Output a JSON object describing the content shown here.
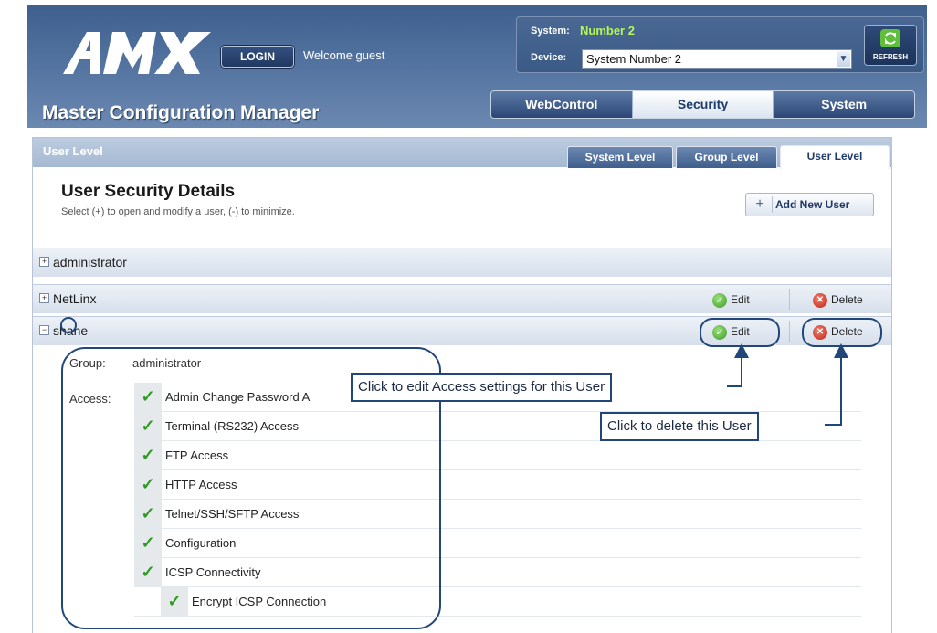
{
  "header": {
    "logo_text": "AMX",
    "login_label": "LOGIN",
    "welcome": "Welcome guest",
    "title": "Master Configuration Manager",
    "system_label": "System:",
    "system_value": "Number 2",
    "device_label": "Device:",
    "device_value": "System Number 2",
    "refresh_label": "REFRESH",
    "nav": [
      "WebControl",
      "Security",
      "System"
    ],
    "nav_active": "Security"
  },
  "panel": {
    "title": "User Level",
    "subtabs": [
      "System Level",
      "Group Level",
      "User Level"
    ],
    "active_subtab": "User Level",
    "section_title": "User Security Details",
    "section_subtitle": "Select (+) to open and modify a user, (-) to minimize.",
    "add_button": "Add New User"
  },
  "users": [
    {
      "name": "administrator",
      "expanded": false,
      "edit": "",
      "delete": ""
    },
    {
      "name": "NetLinx",
      "expanded": false,
      "edit": "Edit",
      "delete": "Delete"
    },
    {
      "name": "shane",
      "expanded": true,
      "edit": "Edit",
      "delete": "Delete"
    }
  ],
  "detail": {
    "group_label": "Group:",
    "group_value": "administrator",
    "access_label": "Access:",
    "permissions": [
      "Admin Change Password A",
      "Terminal (RS232) Access",
      "FTP Access",
      "HTTP Access",
      "Telnet/SSH/SFTP Access",
      "Configuration",
      "ICSP Connectivity",
      "Encrypt ICSP Connection"
    ]
  },
  "callouts": {
    "edit": "Click to edit Access settings for this User",
    "delete": "Click to delete this User"
  },
  "colors": {
    "accent": "#21467a",
    "check": "#2f9a22",
    "header": "#4d6d9b"
  }
}
